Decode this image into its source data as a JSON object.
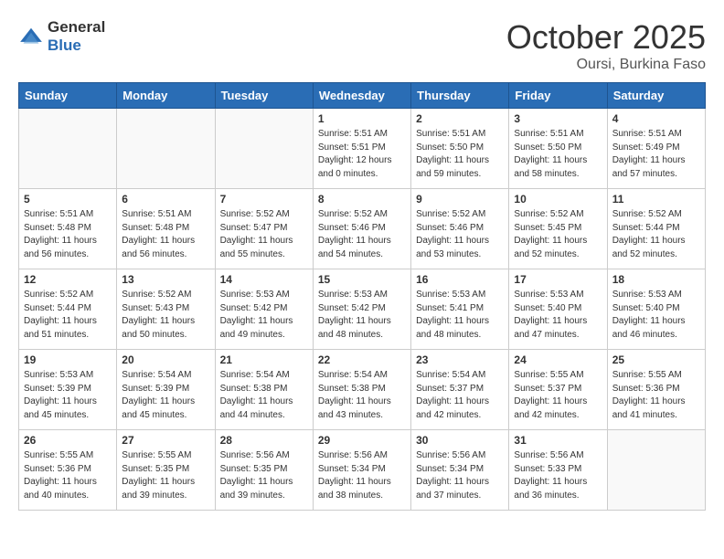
{
  "header": {
    "logo_general": "General",
    "logo_blue": "Blue",
    "month_title": "October 2025",
    "location": "Oursi, Burkina Faso"
  },
  "weekdays": [
    "Sunday",
    "Monday",
    "Tuesday",
    "Wednesday",
    "Thursday",
    "Friday",
    "Saturday"
  ],
  "weeks": [
    [
      {
        "day": "",
        "info": ""
      },
      {
        "day": "",
        "info": ""
      },
      {
        "day": "",
        "info": ""
      },
      {
        "day": "1",
        "info": "Sunrise: 5:51 AM\nSunset: 5:51 PM\nDaylight: 12 hours\nand 0 minutes."
      },
      {
        "day": "2",
        "info": "Sunrise: 5:51 AM\nSunset: 5:50 PM\nDaylight: 11 hours\nand 59 minutes."
      },
      {
        "day": "3",
        "info": "Sunrise: 5:51 AM\nSunset: 5:50 PM\nDaylight: 11 hours\nand 58 minutes."
      },
      {
        "day": "4",
        "info": "Sunrise: 5:51 AM\nSunset: 5:49 PM\nDaylight: 11 hours\nand 57 minutes."
      }
    ],
    [
      {
        "day": "5",
        "info": "Sunrise: 5:51 AM\nSunset: 5:48 PM\nDaylight: 11 hours\nand 56 minutes."
      },
      {
        "day": "6",
        "info": "Sunrise: 5:51 AM\nSunset: 5:48 PM\nDaylight: 11 hours\nand 56 minutes."
      },
      {
        "day": "7",
        "info": "Sunrise: 5:52 AM\nSunset: 5:47 PM\nDaylight: 11 hours\nand 55 minutes."
      },
      {
        "day": "8",
        "info": "Sunrise: 5:52 AM\nSunset: 5:46 PM\nDaylight: 11 hours\nand 54 minutes."
      },
      {
        "day": "9",
        "info": "Sunrise: 5:52 AM\nSunset: 5:46 PM\nDaylight: 11 hours\nand 53 minutes."
      },
      {
        "day": "10",
        "info": "Sunrise: 5:52 AM\nSunset: 5:45 PM\nDaylight: 11 hours\nand 52 minutes."
      },
      {
        "day": "11",
        "info": "Sunrise: 5:52 AM\nSunset: 5:44 PM\nDaylight: 11 hours\nand 52 minutes."
      }
    ],
    [
      {
        "day": "12",
        "info": "Sunrise: 5:52 AM\nSunset: 5:44 PM\nDaylight: 11 hours\nand 51 minutes."
      },
      {
        "day": "13",
        "info": "Sunrise: 5:52 AM\nSunset: 5:43 PM\nDaylight: 11 hours\nand 50 minutes."
      },
      {
        "day": "14",
        "info": "Sunrise: 5:53 AM\nSunset: 5:42 PM\nDaylight: 11 hours\nand 49 minutes."
      },
      {
        "day": "15",
        "info": "Sunrise: 5:53 AM\nSunset: 5:42 PM\nDaylight: 11 hours\nand 48 minutes."
      },
      {
        "day": "16",
        "info": "Sunrise: 5:53 AM\nSunset: 5:41 PM\nDaylight: 11 hours\nand 48 minutes."
      },
      {
        "day": "17",
        "info": "Sunrise: 5:53 AM\nSunset: 5:40 PM\nDaylight: 11 hours\nand 47 minutes."
      },
      {
        "day": "18",
        "info": "Sunrise: 5:53 AM\nSunset: 5:40 PM\nDaylight: 11 hours\nand 46 minutes."
      }
    ],
    [
      {
        "day": "19",
        "info": "Sunrise: 5:53 AM\nSunset: 5:39 PM\nDaylight: 11 hours\nand 45 minutes."
      },
      {
        "day": "20",
        "info": "Sunrise: 5:54 AM\nSunset: 5:39 PM\nDaylight: 11 hours\nand 45 minutes."
      },
      {
        "day": "21",
        "info": "Sunrise: 5:54 AM\nSunset: 5:38 PM\nDaylight: 11 hours\nand 44 minutes."
      },
      {
        "day": "22",
        "info": "Sunrise: 5:54 AM\nSunset: 5:38 PM\nDaylight: 11 hours\nand 43 minutes."
      },
      {
        "day": "23",
        "info": "Sunrise: 5:54 AM\nSunset: 5:37 PM\nDaylight: 11 hours\nand 42 minutes."
      },
      {
        "day": "24",
        "info": "Sunrise: 5:55 AM\nSunset: 5:37 PM\nDaylight: 11 hours\nand 42 minutes."
      },
      {
        "day": "25",
        "info": "Sunrise: 5:55 AM\nSunset: 5:36 PM\nDaylight: 11 hours\nand 41 minutes."
      }
    ],
    [
      {
        "day": "26",
        "info": "Sunrise: 5:55 AM\nSunset: 5:36 PM\nDaylight: 11 hours\nand 40 minutes."
      },
      {
        "day": "27",
        "info": "Sunrise: 5:55 AM\nSunset: 5:35 PM\nDaylight: 11 hours\nand 39 minutes."
      },
      {
        "day": "28",
        "info": "Sunrise: 5:56 AM\nSunset: 5:35 PM\nDaylight: 11 hours\nand 39 minutes."
      },
      {
        "day": "29",
        "info": "Sunrise: 5:56 AM\nSunset: 5:34 PM\nDaylight: 11 hours\nand 38 minutes."
      },
      {
        "day": "30",
        "info": "Sunrise: 5:56 AM\nSunset: 5:34 PM\nDaylight: 11 hours\nand 37 minutes."
      },
      {
        "day": "31",
        "info": "Sunrise: 5:56 AM\nSunset: 5:33 PM\nDaylight: 11 hours\nand 36 minutes."
      },
      {
        "day": "",
        "info": ""
      }
    ]
  ]
}
